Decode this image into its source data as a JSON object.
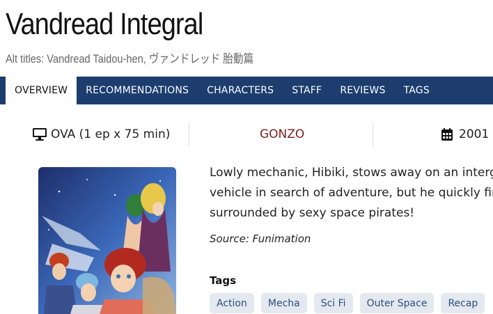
{
  "title": "Vandread Integral",
  "alt_titles": "Alt titles: Vandread Taidou-hen, ヴァンドレッド 胎動篇",
  "tabs": [
    {
      "label": "OVERVIEW",
      "active": true
    },
    {
      "label": "RECOMMENDATIONS"
    },
    {
      "label": "CHARACTERS"
    },
    {
      "label": "STAFF"
    },
    {
      "label": "REVIEWS"
    },
    {
      "label": "TAGS"
    }
  ],
  "info": {
    "type_icon": "monitor-icon",
    "type": "OVA (1 ep x 75 min)",
    "studio": "GONZO",
    "year_icon": "calendar-icon",
    "year": "2001"
  },
  "synopsis": {
    "lines": [
      "Lowly mechanic, Hibiki, stows away on an intergal",
      "vehicle in search of adventure, but he quickly finds",
      "surrounded by sexy space pirates!"
    ],
    "source": "Source: Funimation"
  },
  "tags": {
    "heading": "Tags",
    "items": [
      "Action",
      "Mecha",
      "Sci Fi",
      "Outer Space",
      "Recap"
    ]
  },
  "colors": {
    "nav_bg": "#1c3d6e",
    "studio": "#7a2020",
    "tag_bg": "#e4e8ef",
    "tag_text": "#2b4f7e"
  }
}
